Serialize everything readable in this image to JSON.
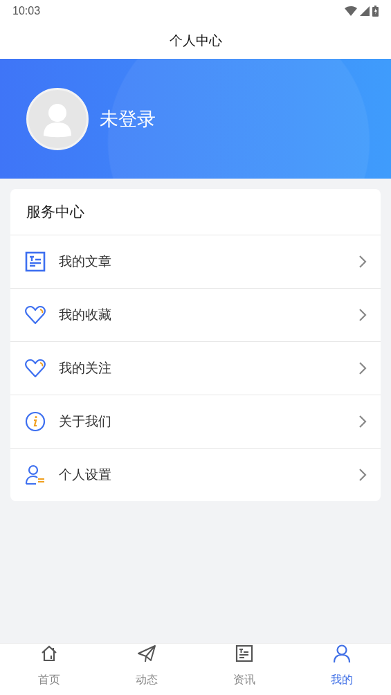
{
  "status_bar": {
    "time": "10:03"
  },
  "title": "个人中心",
  "profile": {
    "name": "未登录"
  },
  "service": {
    "title": "服务中心",
    "items": [
      {
        "kind": "article",
        "label": "我的文章"
      },
      {
        "kind": "heart",
        "label": "我的收藏"
      },
      {
        "kind": "heart",
        "label": "我的关注"
      },
      {
        "kind": "info",
        "label": "关于我们"
      },
      {
        "kind": "user",
        "label": "个人设置"
      }
    ]
  },
  "tabs": [
    {
      "kind": "home",
      "label": "首页",
      "selected": false
    },
    {
      "kind": "send",
      "label": "动态",
      "selected": false
    },
    {
      "kind": "news",
      "label": "资讯",
      "selected": false
    },
    {
      "kind": "user",
      "label": "我的",
      "selected": true
    }
  ]
}
